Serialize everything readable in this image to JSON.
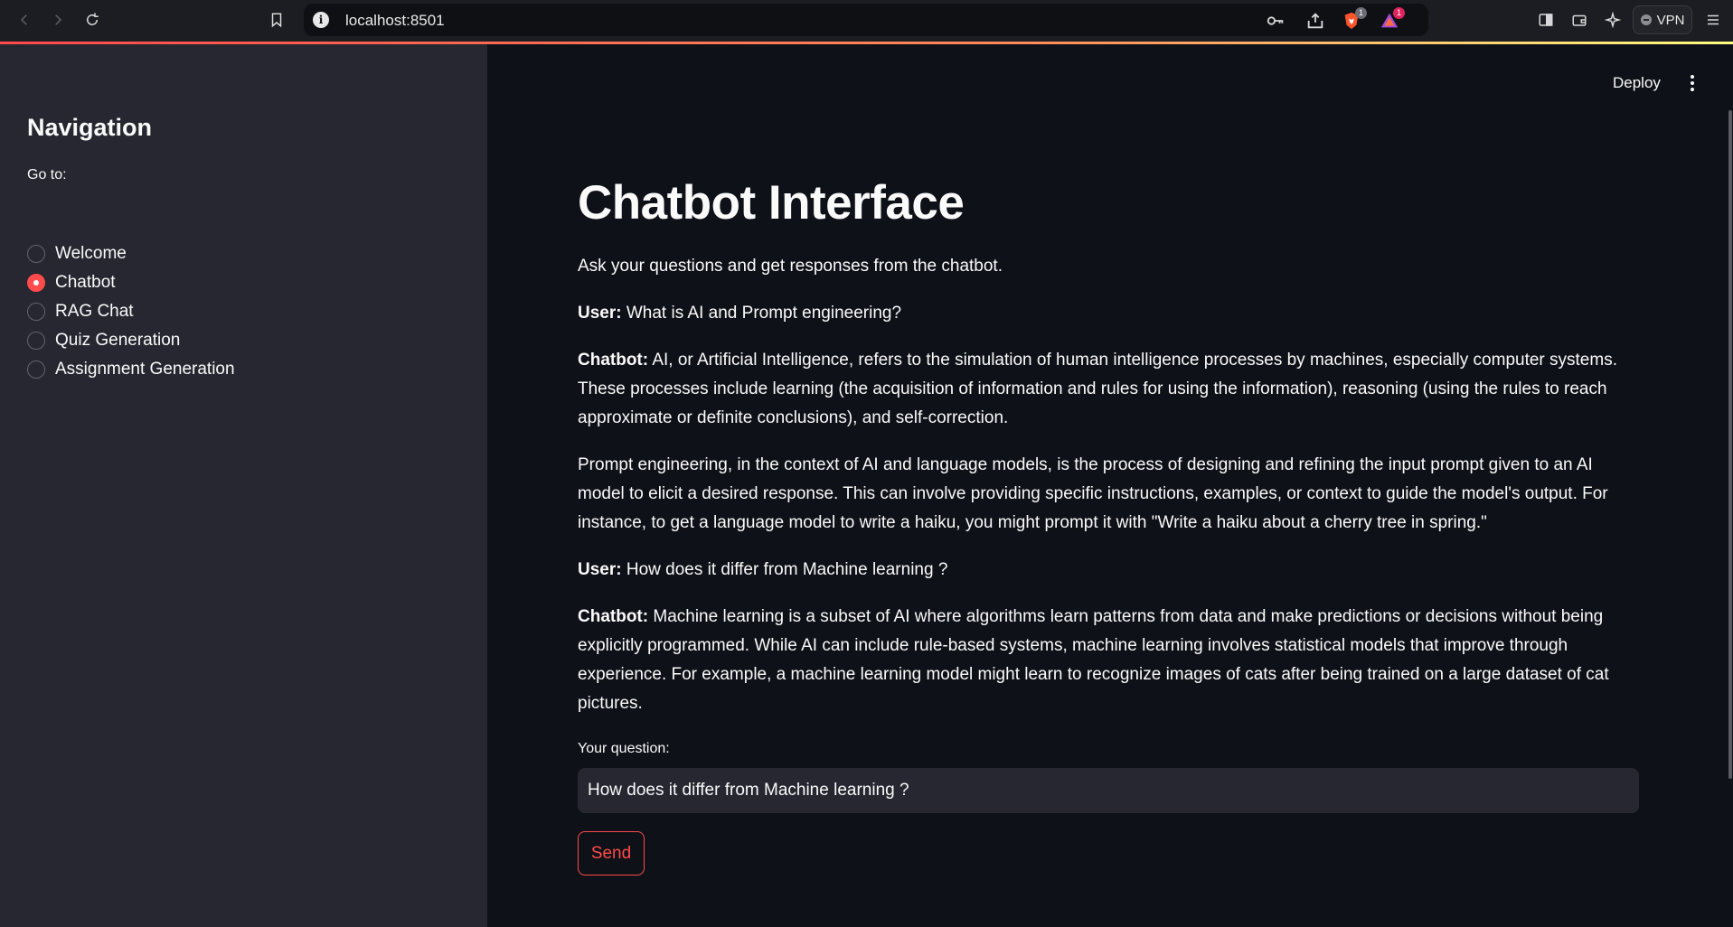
{
  "browser": {
    "url": "localhost:8501",
    "vpn_label": "VPN",
    "brave_badge": "1",
    "rewards_badge": "1"
  },
  "sidebar": {
    "title": "Navigation",
    "radio_label": "Go to:",
    "options": [
      {
        "label": "Welcome",
        "selected": false
      },
      {
        "label": "Chatbot",
        "selected": true
      },
      {
        "label": "RAG Chat",
        "selected": false
      },
      {
        "label": "Quiz Generation",
        "selected": false
      },
      {
        "label": "Assignment Generation",
        "selected": false
      }
    ]
  },
  "header": {
    "deploy_label": "Deploy"
  },
  "main": {
    "title": "Chatbot Interface",
    "intro": "Ask your questions and get responses from the chatbot.",
    "messages": [
      {
        "speaker": "User:",
        "text": " What is AI and Prompt engineering?"
      },
      {
        "speaker": "Chatbot:",
        "text": " AI, or Artificial Intelligence, refers to the simulation of human intelligence processes by machines, especially computer systems. These processes include learning (the acquisition of information and rules for using the information), reasoning (using the rules to reach approximate or definite conclusions), and self-correction."
      },
      {
        "speaker": "",
        "text": "Prompt engineering, in the context of AI and language models, is the process of designing and refining the input prompt given to an AI model to elicit a desired response. This can involve providing specific instructions, examples, or context to guide the model's output. For instance, to get a language model to write a haiku, you might prompt it with \"Write a haiku about a cherry tree in spring.\""
      },
      {
        "speaker": "User:",
        "text": " How does it differ from Machine learning ?"
      },
      {
        "speaker": "Chatbot:",
        "text": " Machine learning is a subset of AI where algorithms learn patterns from data and make predictions or decisions without being explicitly programmed. While AI can include rule-based systems, machine learning involves statistical models that improve through experience. For example, a machine learning model might learn to recognize images of cats after being trained on a large dataset of cat pictures."
      }
    ],
    "question_label": "Your question:",
    "question_value": "How does it differ from Machine learning ?",
    "send_label": "Send"
  },
  "colors": {
    "accent": "#ff4b4b",
    "sidebar_bg": "#262730",
    "main_bg": "#0e1117"
  }
}
